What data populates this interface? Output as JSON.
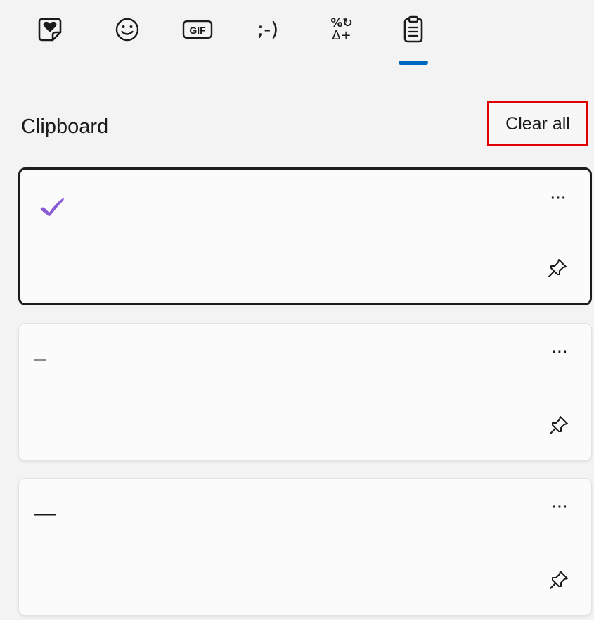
{
  "colors": {
    "accent": "#0067c0",
    "check": "#8a5cd6",
    "highlight": "#e00000"
  },
  "tabs": [
    {
      "name": "tab-favorites",
      "icon": "heart-sticker-icon"
    },
    {
      "name": "tab-emoji",
      "icon": "smiley-icon"
    },
    {
      "name": "tab-gif",
      "icon": "gif-icon"
    },
    {
      "name": "tab-kaomoji",
      "label": ";-)"
    },
    {
      "name": "tab-symbols",
      "label_top": "%↻",
      "label_bottom": "Δ+"
    },
    {
      "name": "tab-clipboard",
      "icon": "clipboard-icon",
      "selected": true
    }
  ],
  "clipboard": {
    "title": "Clipboard",
    "clear_all_label": "Clear all",
    "items": [
      {
        "content_icon": "check-mark-icon",
        "selected": true,
        "more_label": "···"
      },
      {
        "content": "–",
        "selected": false,
        "more_label": "···"
      },
      {
        "content": "—",
        "selected": false,
        "more_label": "···"
      }
    ]
  }
}
